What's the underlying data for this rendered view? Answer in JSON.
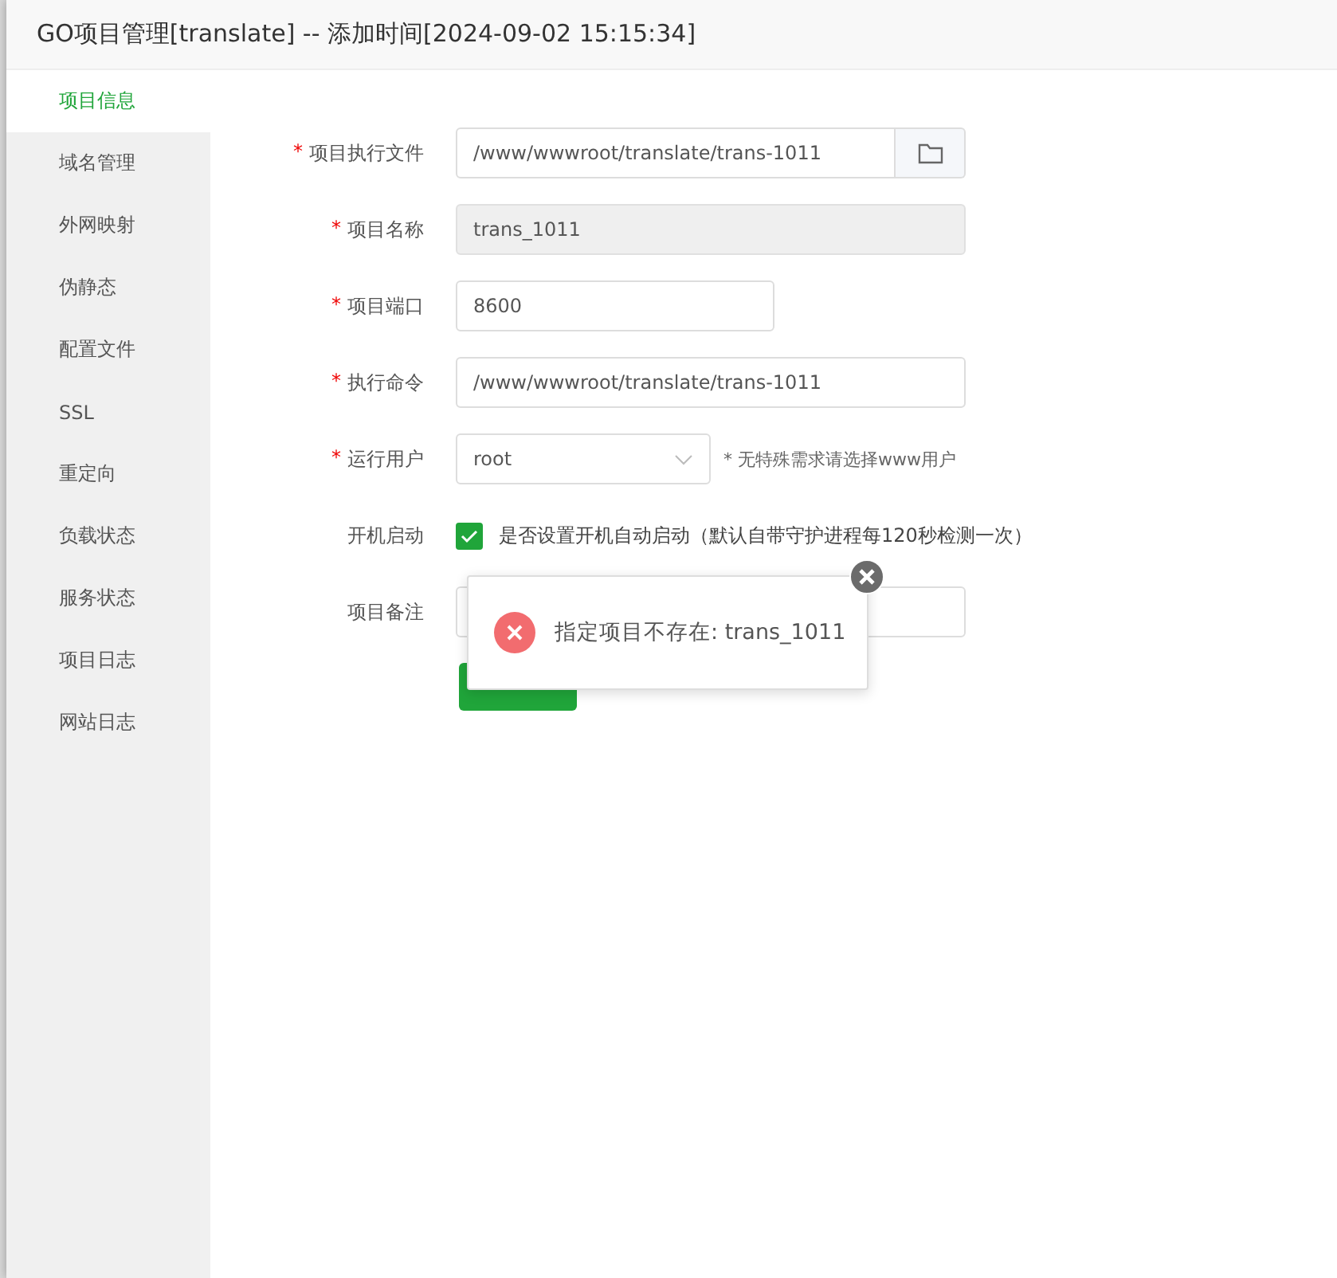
{
  "window": {
    "title": "GO项目管理[translate] -- 添加时间[2024-09-02 15:15:34]"
  },
  "sidebar": {
    "items": [
      {
        "label": "项目信息",
        "selected": true
      },
      {
        "label": "域名管理",
        "selected": false
      },
      {
        "label": "外网映射",
        "selected": false
      },
      {
        "label": "伪静态",
        "selected": false
      },
      {
        "label": "配置文件",
        "selected": false
      },
      {
        "label": "SSL",
        "selected": false
      },
      {
        "label": "重定向",
        "selected": false
      },
      {
        "label": "负载状态",
        "selected": false
      },
      {
        "label": "服务状态",
        "selected": false
      },
      {
        "label": "项目日志",
        "selected": false
      },
      {
        "label": "网站日志",
        "selected": false
      }
    ]
  },
  "form": {
    "fields": [
      {
        "kind": "file",
        "mark": "*",
        "label": "项目执行文件",
        "value": "/www/wwwroot/translate/trans-1011",
        "disabled": false
      },
      {
        "kind": "text",
        "mark": "*",
        "label": "项目名称",
        "value": "trans_1011",
        "disabled": true
      },
      {
        "kind": "short",
        "mark": "*",
        "label": "项目端口",
        "value": "8600",
        "disabled": false
      },
      {
        "kind": "text",
        "mark": "*",
        "label": "执行命令",
        "value": "/www/wwwroot/translate/trans-1011",
        "disabled": false
      },
      {
        "kind": "select",
        "mark": "*",
        "label": "运行用户",
        "value": "root",
        "hint": "* 无特殊需求请选择www用户"
      },
      {
        "kind": "checkbox",
        "label": "开机启动",
        "checked": true,
        "text": "是否设置开机自动启动（默认自带守护进程每120秒检测一次）"
      },
      {
        "kind": "text",
        "label": "项目备注",
        "disabled": false
      }
    ],
    "save_button": {
      "kind": "button"
    }
  },
  "toast": {
    "message": "指定项目不存在: trans_1011"
  }
}
